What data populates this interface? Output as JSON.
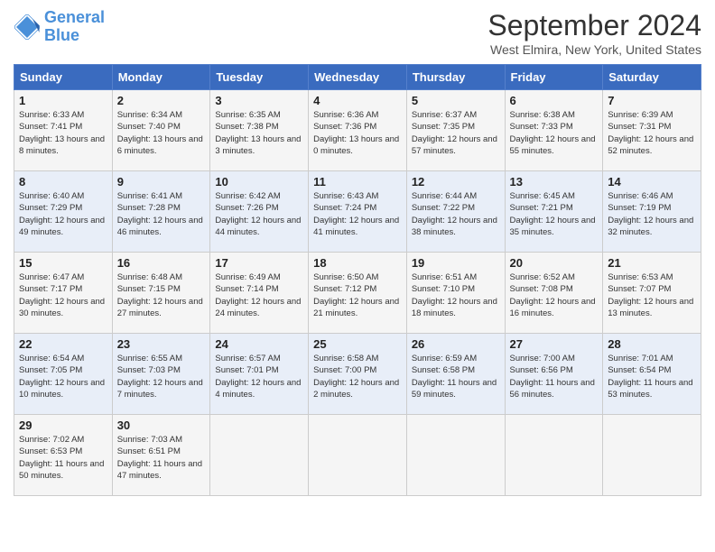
{
  "logo": {
    "line1": "General",
    "line2": "Blue"
  },
  "title": "September 2024",
  "location": "West Elmira, New York, United States",
  "days_of_week": [
    "Sunday",
    "Monday",
    "Tuesday",
    "Wednesday",
    "Thursday",
    "Friday",
    "Saturday"
  ],
  "weeks": [
    [
      {
        "day": "1",
        "sunrise": "6:33 AM",
        "sunset": "7:41 PM",
        "daylight": "13 hours and 8 minutes."
      },
      {
        "day": "2",
        "sunrise": "6:34 AM",
        "sunset": "7:40 PM",
        "daylight": "13 hours and 6 minutes."
      },
      {
        "day": "3",
        "sunrise": "6:35 AM",
        "sunset": "7:38 PM",
        "daylight": "13 hours and 3 minutes."
      },
      {
        "day": "4",
        "sunrise": "6:36 AM",
        "sunset": "7:36 PM",
        "daylight": "13 hours and 0 minutes."
      },
      {
        "day": "5",
        "sunrise": "6:37 AM",
        "sunset": "7:35 PM",
        "daylight": "12 hours and 57 minutes."
      },
      {
        "day": "6",
        "sunrise": "6:38 AM",
        "sunset": "7:33 PM",
        "daylight": "12 hours and 55 minutes."
      },
      {
        "day": "7",
        "sunrise": "6:39 AM",
        "sunset": "7:31 PM",
        "daylight": "12 hours and 52 minutes."
      }
    ],
    [
      {
        "day": "8",
        "sunrise": "6:40 AM",
        "sunset": "7:29 PM",
        "daylight": "12 hours and 49 minutes."
      },
      {
        "day": "9",
        "sunrise": "6:41 AM",
        "sunset": "7:28 PM",
        "daylight": "12 hours and 46 minutes."
      },
      {
        "day": "10",
        "sunrise": "6:42 AM",
        "sunset": "7:26 PM",
        "daylight": "12 hours and 44 minutes."
      },
      {
        "day": "11",
        "sunrise": "6:43 AM",
        "sunset": "7:24 PM",
        "daylight": "12 hours and 41 minutes."
      },
      {
        "day": "12",
        "sunrise": "6:44 AM",
        "sunset": "7:22 PM",
        "daylight": "12 hours and 38 minutes."
      },
      {
        "day": "13",
        "sunrise": "6:45 AM",
        "sunset": "7:21 PM",
        "daylight": "12 hours and 35 minutes."
      },
      {
        "day": "14",
        "sunrise": "6:46 AM",
        "sunset": "7:19 PM",
        "daylight": "12 hours and 32 minutes."
      }
    ],
    [
      {
        "day": "15",
        "sunrise": "6:47 AM",
        "sunset": "7:17 PM",
        "daylight": "12 hours and 30 minutes."
      },
      {
        "day": "16",
        "sunrise": "6:48 AM",
        "sunset": "7:15 PM",
        "daylight": "12 hours and 27 minutes."
      },
      {
        "day": "17",
        "sunrise": "6:49 AM",
        "sunset": "7:14 PM",
        "daylight": "12 hours and 24 minutes."
      },
      {
        "day": "18",
        "sunrise": "6:50 AM",
        "sunset": "7:12 PM",
        "daylight": "12 hours and 21 minutes."
      },
      {
        "day": "19",
        "sunrise": "6:51 AM",
        "sunset": "7:10 PM",
        "daylight": "12 hours and 18 minutes."
      },
      {
        "day": "20",
        "sunrise": "6:52 AM",
        "sunset": "7:08 PM",
        "daylight": "12 hours and 16 minutes."
      },
      {
        "day": "21",
        "sunrise": "6:53 AM",
        "sunset": "7:07 PM",
        "daylight": "12 hours and 13 minutes."
      }
    ],
    [
      {
        "day": "22",
        "sunrise": "6:54 AM",
        "sunset": "7:05 PM",
        "daylight": "12 hours and 10 minutes."
      },
      {
        "day": "23",
        "sunrise": "6:55 AM",
        "sunset": "7:03 PM",
        "daylight": "12 hours and 7 minutes."
      },
      {
        "day": "24",
        "sunrise": "6:57 AM",
        "sunset": "7:01 PM",
        "daylight": "12 hours and 4 minutes."
      },
      {
        "day": "25",
        "sunrise": "6:58 AM",
        "sunset": "7:00 PM",
        "daylight": "12 hours and 2 minutes."
      },
      {
        "day": "26",
        "sunrise": "6:59 AM",
        "sunset": "6:58 PM",
        "daylight": "11 hours and 59 minutes."
      },
      {
        "day": "27",
        "sunrise": "7:00 AM",
        "sunset": "6:56 PM",
        "daylight": "11 hours and 56 minutes."
      },
      {
        "day": "28",
        "sunrise": "7:01 AM",
        "sunset": "6:54 PM",
        "daylight": "11 hours and 53 minutes."
      }
    ],
    [
      {
        "day": "29",
        "sunrise": "7:02 AM",
        "sunset": "6:53 PM",
        "daylight": "11 hours and 50 minutes."
      },
      {
        "day": "30",
        "sunrise": "7:03 AM",
        "sunset": "6:51 PM",
        "daylight": "11 hours and 47 minutes."
      },
      null,
      null,
      null,
      null,
      null
    ]
  ]
}
